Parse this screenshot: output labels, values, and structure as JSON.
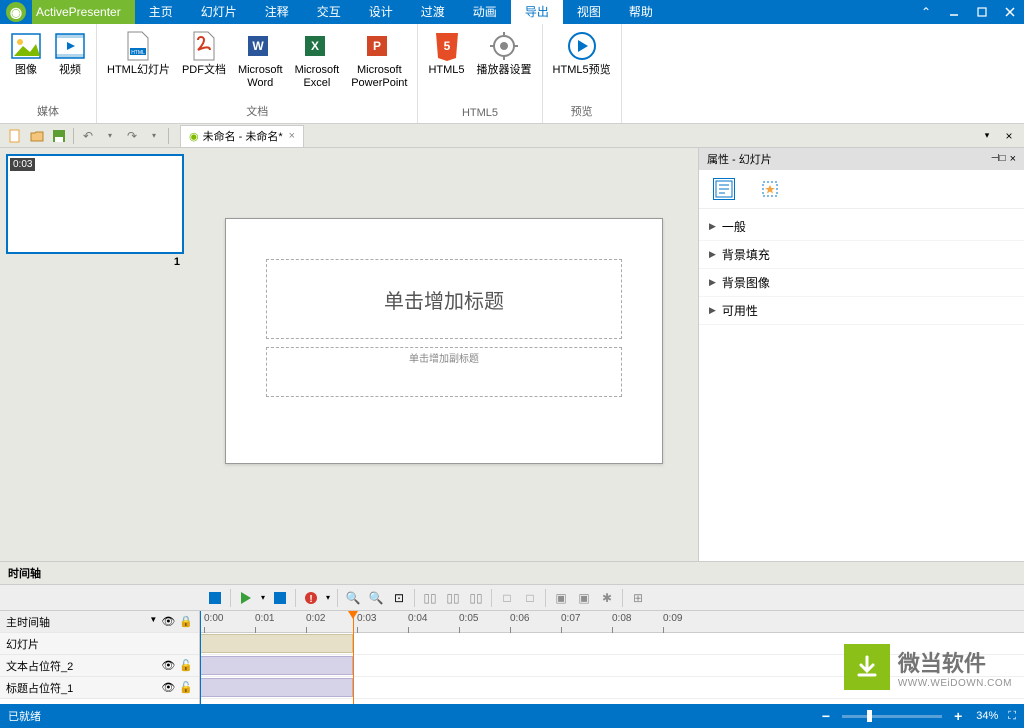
{
  "app": {
    "name": "ActivePresenter"
  },
  "menu": {
    "tabs": [
      "主页",
      "幻灯片",
      "注释",
      "交互",
      "设计",
      "过渡",
      "动画",
      "导出",
      "视图",
      "帮助"
    ],
    "active_index": 7
  },
  "ribbon": {
    "media": {
      "label": "媒体",
      "image": "图像",
      "video": "视频"
    },
    "docs": {
      "label": "文档",
      "html_slides": "HTML幻灯片",
      "pdf": "PDF文档",
      "word": "Microsoft\nWord",
      "excel": "Microsoft\nExcel",
      "ppt": "Microsoft\nPowerPoint"
    },
    "html5": {
      "label": "HTML5",
      "html5": "HTML5",
      "player": "播放器设置"
    },
    "preview": {
      "label": "预览",
      "btn": "HTML5预览"
    }
  },
  "doc": {
    "tab_title": "未命名 - 未命名*"
  },
  "slide": {
    "thumb_time": "0:03",
    "number": "1",
    "title_placeholder": "单击增加标题",
    "subtitle_placeholder": "单击增加副标题"
  },
  "props": {
    "header": "属性  -  幻灯片",
    "items": [
      "一般",
      "背景填充",
      "背景图像",
      "可用性"
    ]
  },
  "timeline": {
    "header": "时间轴",
    "main_track": "主时间轴",
    "tracks": [
      "幻灯片",
      "文本占位符_2",
      "标题占位符_1"
    ],
    "ticks": [
      "0:00",
      "0:01",
      "0:02",
      "0:03",
      "0:04",
      "0:05",
      "0:06",
      "0:07",
      "0:08",
      "0:09"
    ]
  },
  "status": {
    "ready": "已就绪",
    "zoom": "34%"
  },
  "watermark": {
    "title": "微当软件",
    "url": "WWW.WEiDOWN.COM"
  }
}
